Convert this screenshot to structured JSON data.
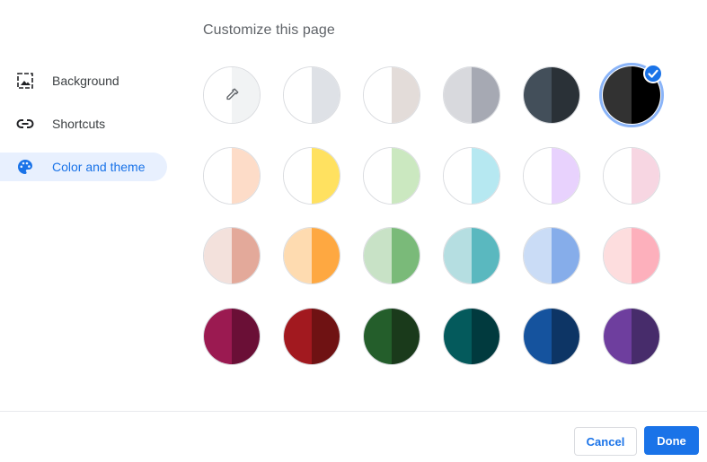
{
  "header": {
    "title": "Customize this page"
  },
  "sidebar": {
    "items": [
      {
        "label": "Background",
        "icon": "background-image-icon",
        "active": false
      },
      {
        "label": "Shortcuts",
        "icon": "link-icon",
        "active": false
      },
      {
        "label": "Color and theme",
        "icon": "palette-icon",
        "active": true
      }
    ]
  },
  "themes": {
    "selected_index": 5,
    "colors": [
      [
        "#ffffff",
        "#f1f3f4"
      ],
      [
        "#ffffff",
        "#dee1e6"
      ],
      [
        "#ffffff",
        "#e3dcd9"
      ],
      [
        "#d8d9dd",
        "#a6a9b3"
      ],
      [
        "#434f5a",
        "#2a3137"
      ],
      [
        "#323232",
        "#000000"
      ],
      [
        "#ffffff",
        "#fddcc8"
      ],
      [
        "#ffffff",
        "#ffe160"
      ],
      [
        "#ffffff",
        "#cbe8c0"
      ],
      [
        "#ffffff",
        "#b6e8f1"
      ],
      [
        "#ffffff",
        "#e8d2fd"
      ],
      [
        "#ffffff",
        "#f7d6e2"
      ],
      [
        "#f3e1dc",
        "#e3a99a"
      ],
      [
        "#fedbb0",
        "#fea841"
      ],
      [
        "#c8e2c6",
        "#7aba79"
      ],
      [
        "#b5dee1",
        "#5ab8bf"
      ],
      [
        "#cadcf6",
        "#86adea"
      ],
      [
        "#fdddde",
        "#fdb0bc"
      ],
      [
        "#9b1a51",
        "#6a0f36"
      ],
      [
        "#a2191f",
        "#6f1213"
      ],
      [
        "#245e2b",
        "#1a3a1b"
      ],
      [
        "#045a5c",
        "#013a3e"
      ],
      [
        "#15539e",
        "#0d3565"
      ],
      [
        "#6e3e9e",
        "#472c6b"
      ]
    ]
  },
  "footer": {
    "cancel_label": "Cancel",
    "done_label": "Done"
  },
  "colors": {
    "accent": "#1a73e8",
    "active_bg": "#e8f0fe"
  }
}
